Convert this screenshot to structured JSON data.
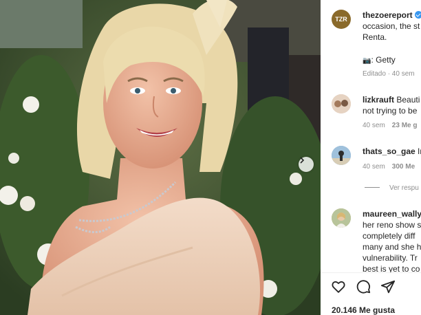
{
  "post": {
    "author": "thezoereport",
    "author_avatar_text": "TZR",
    "caption_line1": "occasion, the st",
    "caption_line2": "Renta.",
    "credit_emoji": "📷",
    "credit_text": ": Getty",
    "edited_label": "Editado · 40 sem"
  },
  "comments": [
    {
      "user": "lizkrauft",
      "text_line1": "Beauti",
      "text_line2": "not trying to be",
      "time": "40 sem",
      "likes": "23 Me g"
    },
    {
      "user": "thats_so_gae",
      "text_line1": "In",
      "time": "40 sem",
      "likes": "300 Me"
    },
    {
      "user": "maureen_wally",
      "text_line1": "her reno show s",
      "text_line2": "completely diff",
      "text_line3": "many and she h",
      "text_line4": "vulnerability. Tr",
      "text_line5": "best is yet to co"
    }
  ],
  "replies_label": "Ver respu",
  "likes_total": "20.146 Me gusta",
  "icons": {
    "like": "heart-icon",
    "comment": "comment-icon",
    "share": "share-icon",
    "next": "chevron-right-icon"
  },
  "colors": {
    "verified": "#3897f0",
    "muted_text": "#8e8e8e",
    "avatar_tzr": "#8a6a2b"
  }
}
